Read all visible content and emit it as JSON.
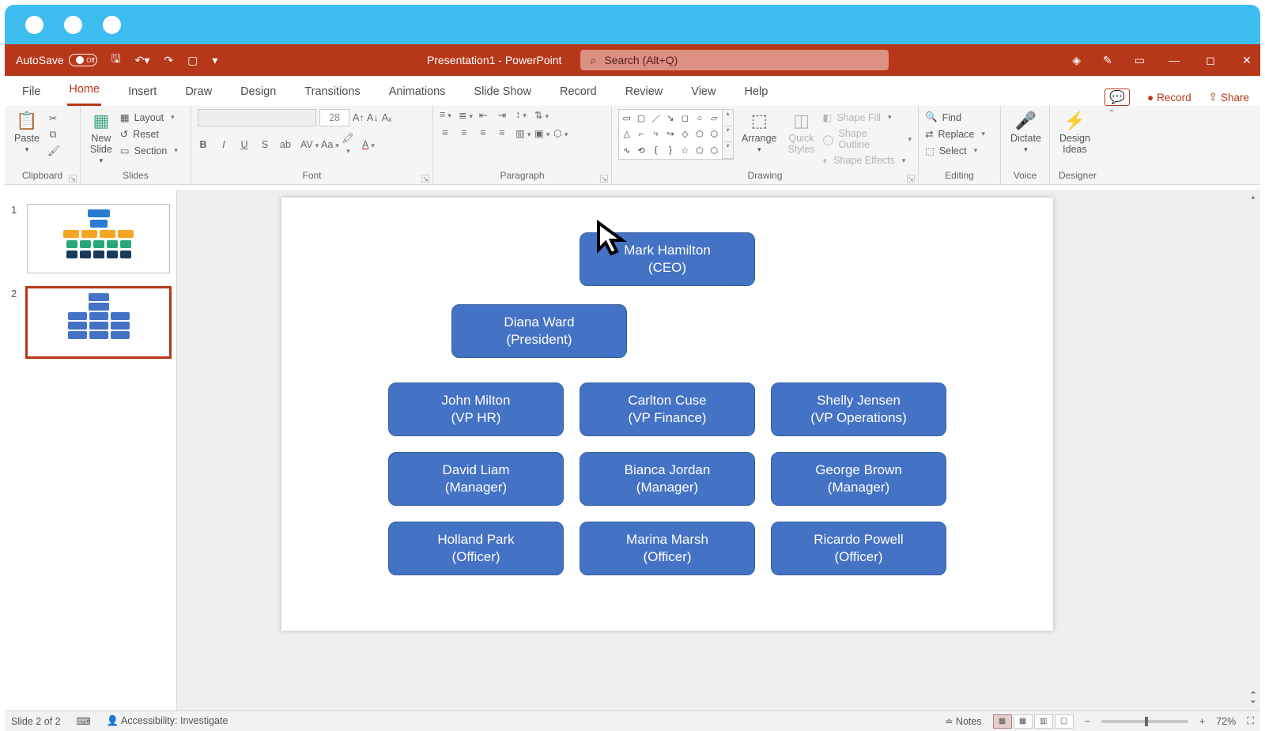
{
  "titlebar": {
    "autosave_label": "AutoSave",
    "autosave_state": "Off",
    "doc_title": "Presentation1 - PowerPoint",
    "search_placeholder": "Search (Alt+Q)"
  },
  "tabs": {
    "items": [
      "File",
      "Home",
      "Insert",
      "Draw",
      "Design",
      "Transitions",
      "Animations",
      "Slide Show",
      "Record",
      "Review",
      "View",
      "Help"
    ],
    "active_index": 1,
    "comments_label": "",
    "record_label": "Record",
    "share_label": "Share"
  },
  "ribbon": {
    "clipboard": {
      "label": "Clipboard",
      "paste": "Paste"
    },
    "slides": {
      "label": "Slides",
      "new_slide": "New\nSlide",
      "layout": "Layout",
      "reset": "Reset",
      "section": "Section"
    },
    "font": {
      "label": "Font",
      "size": "28"
    },
    "paragraph": {
      "label": "Paragraph"
    },
    "drawing": {
      "label": "Drawing",
      "arrange": "Arrange",
      "quick_styles": "Quick\nStyles",
      "shape_fill": "Shape Fill",
      "shape_outline": "Shape Outline",
      "shape_effects": "Shape Effects"
    },
    "editing": {
      "label": "Editing",
      "find": "Find",
      "replace": "Replace",
      "select": "Select"
    },
    "voice": {
      "label": "Voice",
      "dictate": "Dictate"
    },
    "designer": {
      "label": "Designer",
      "ideas": "Design\nIdeas"
    }
  },
  "slide": {
    "org": [
      {
        "name": "Mark Hamilton",
        "role": "(CEO)"
      },
      {
        "name": "Diana Ward",
        "role": "(President)"
      },
      {
        "name": "John Milton",
        "role": "(VP HR)"
      },
      {
        "name": "Carlton Cuse",
        "role": "(VP Finance)"
      },
      {
        "name": "Shelly Jensen",
        "role": "(VP Operations)"
      },
      {
        "name": "David Liam",
        "role": "(Manager)"
      },
      {
        "name": "Bianca Jordan",
        "role": "(Manager)"
      },
      {
        "name": "George Brown",
        "role": "(Manager)"
      },
      {
        "name": "Holland Park",
        "role": "(Officer)"
      },
      {
        "name": "Marina Marsh",
        "role": "(Officer)"
      },
      {
        "name": "Ricardo Powell",
        "role": "(Officer)"
      }
    ]
  },
  "thumbnails": {
    "count": 2,
    "selected": 2
  },
  "statusbar": {
    "slide_info": "Slide 2 of 2",
    "accessibility": "Accessibility: Investigate",
    "notes": "Notes",
    "zoom": "72%"
  }
}
